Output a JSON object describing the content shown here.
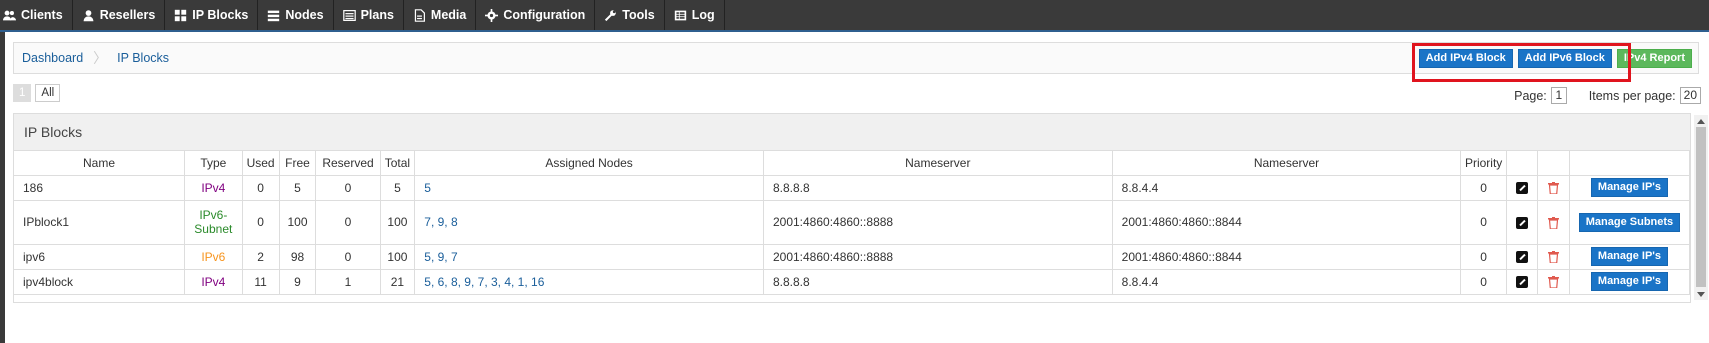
{
  "nav": {
    "items": [
      {
        "label": "Clients",
        "icon": "users-icon"
      },
      {
        "label": "Resellers",
        "icon": "user-icon"
      },
      {
        "label": "IP Blocks",
        "icon": "grid-icon"
      },
      {
        "label": "Nodes",
        "icon": "server-icon"
      },
      {
        "label": "Plans",
        "icon": "list-icon"
      },
      {
        "label": "Media",
        "icon": "file-icon"
      },
      {
        "label": "Configuration",
        "icon": "gear-icon"
      },
      {
        "label": "Tools",
        "icon": "wrench-icon"
      },
      {
        "label": "Log",
        "icon": "table-icon"
      }
    ]
  },
  "breadcrumb": {
    "home": "Dashboard",
    "current": "IP Blocks"
  },
  "actions": {
    "add_ipv4": "Add IPv4 Block",
    "add_ipv6": "Add IPv6 Block",
    "ipv4_report": "IPv4 Report"
  },
  "pager": {
    "page_one": "1",
    "all": "All",
    "page_label": "Page:",
    "page_value": "1",
    "items_label": "Items per page:",
    "items_value": "20"
  },
  "panel": {
    "title": "IP Blocks",
    "columns": [
      "Name",
      "Type",
      "Used",
      "Free",
      "Reserved",
      "Total",
      "Assigned Nodes",
      "Nameserver",
      "Nameserver",
      "Priority"
    ],
    "rows": [
      {
        "name": "186",
        "type": "IPv4",
        "type_style": "ipv4",
        "used": "0",
        "free": "5",
        "reserved": "0",
        "total": "5",
        "nodes": "5",
        "ns1": "8.8.8.8",
        "ns2": "8.8.4.4",
        "priority": "0",
        "manage": "Manage IP's"
      },
      {
        "name": "IPblock1",
        "type": "IPv6-Subnet",
        "type_style": "subnet",
        "used": "0",
        "free": "100",
        "reserved": "0",
        "total": "100",
        "nodes": "7, 9, 8",
        "ns1": "2001:4860:4860::8888",
        "ns2": "2001:4860:4860::8844",
        "priority": "0",
        "manage": "Manage Subnets"
      },
      {
        "name": "ipv6",
        "type": "IPv6",
        "type_style": "ipv6",
        "used": "2",
        "free": "98",
        "reserved": "0",
        "total": "100",
        "nodes": "5, 9, 7",
        "ns1": "2001:4860:4860::8888",
        "ns2": "2001:4860:4860::8844",
        "priority": "0",
        "manage": "Manage IP's"
      },
      {
        "name": "ipv4block",
        "type": "IPv4",
        "type_style": "ipv4",
        "used": "11",
        "free": "9",
        "reserved": "1",
        "total": "21",
        "nodes": "5, 6, 8, 9, 7, 3, 4, 1, 16",
        "ns1": "8.8.8.8",
        "ns2": "8.8.4.4",
        "priority": "0",
        "manage": "Manage IP's"
      }
    ]
  },
  "colors": {
    "nav_bg": "#3a3a3a",
    "primary_button": "#1a74c7",
    "report_button": "#5cb85c",
    "highlight_box": "#e0141e",
    "ipv4_text": "#800080",
    "ipv6_text": "#f7941d",
    "subnet_text": "#2a8a2a"
  }
}
